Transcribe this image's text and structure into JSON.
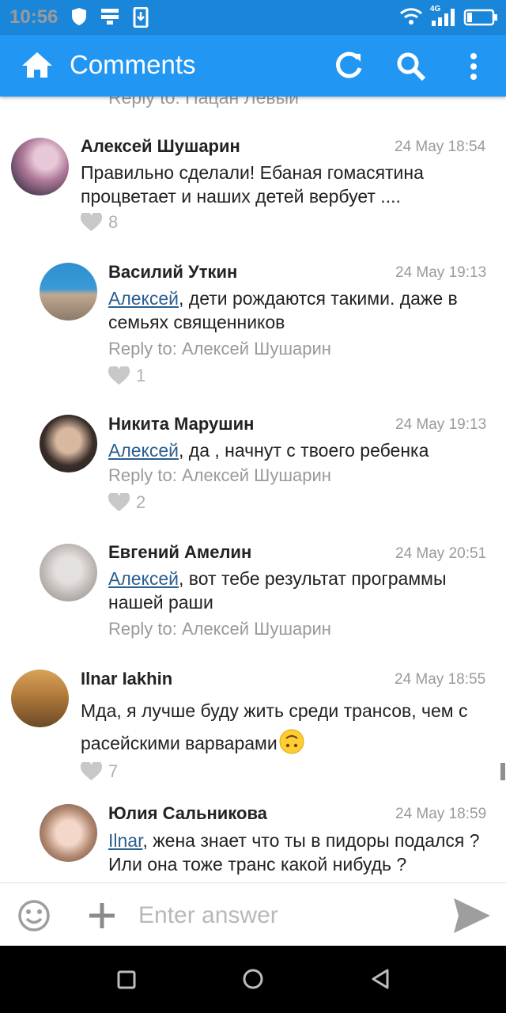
{
  "status_bar": {
    "time": "10:56",
    "network": "4G"
  },
  "app_bar": {
    "title": "Comments"
  },
  "comments": {
    "partial_reply": "Reply to: Пацан Левый",
    "c1": {
      "name": "Алексей Шушарин",
      "time": "24 May 18:54",
      "text": "Правильно сделали! Ебаная гомасятина процветает и наших детей вербует ....",
      "likes": "8"
    },
    "c2": {
      "name": "Василий Уткин",
      "time": "24 May 19:13",
      "mention": "Алексей",
      "text": ", дети рождаются такими. даже в семьях священников",
      "reply_to": "Reply to: Алексей Шушарин",
      "likes": "1"
    },
    "c3": {
      "name": "Никита Марушин",
      "time": "24 May 19:13",
      "mention": "Алексей",
      "text": ", да , начнут с твоего ребенка",
      "reply_to": "Reply to: Алексей Шушарин",
      "likes": "2"
    },
    "c4": {
      "name": "Евгений Амелин",
      "time": "24 May 20:51",
      "mention": "Алексей",
      "text": ", вот тебе результат программы нашей раши",
      "reply_to": "Reply to: Алексей Шушарин"
    },
    "c5": {
      "name": "Ilnar Iakhin",
      "time": "24 May 18:55",
      "text": "Мда, я лучше буду жить среди трансов, чем с расейскими варварами",
      "likes": "7"
    },
    "c6": {
      "name": "Юлия Сальникова",
      "time": "24 May 18:59",
      "mention": "Ilnar",
      "text": ", жена знает что ты в пидоры подался ? Или она тоже транс какой нибудь ?"
    }
  },
  "input": {
    "placeholder": "Enter answer"
  }
}
